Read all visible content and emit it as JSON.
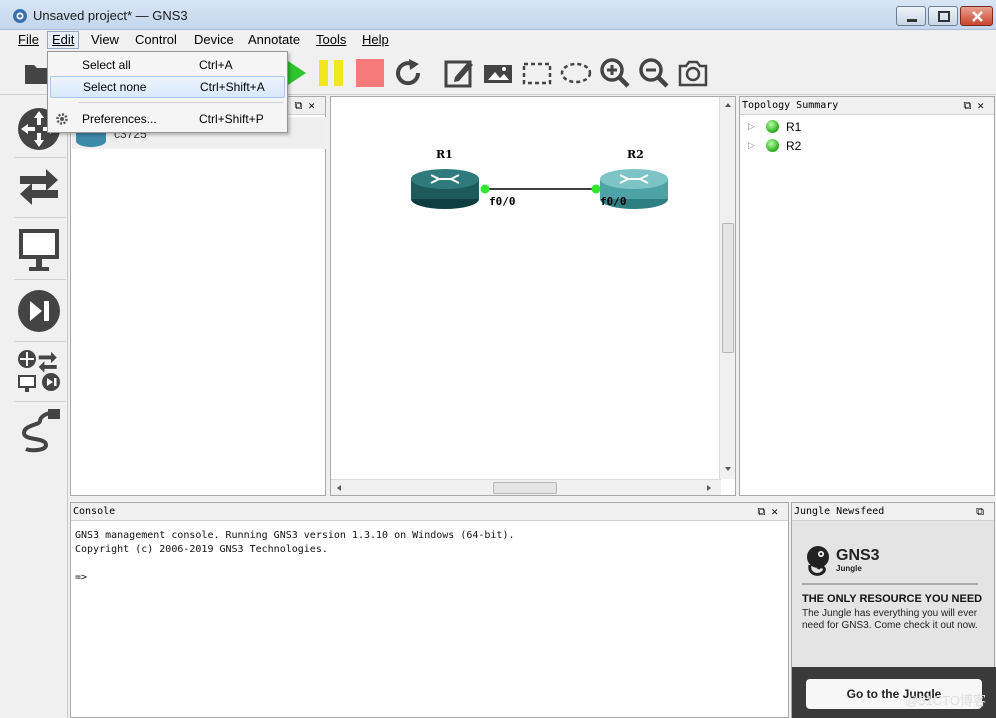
{
  "window": {
    "title": "Unsaved project* — GNS3"
  },
  "menubar": {
    "items": [
      "File",
      "Edit",
      "View",
      "Control",
      "Device",
      "Annotate",
      "Tools",
      "Help"
    ]
  },
  "edit_menu": {
    "items": [
      {
        "label": "Select all",
        "shortcut": "Ctrl+A"
      },
      {
        "label": "Select none",
        "shortcut": "Ctrl+Shift+A"
      },
      {
        "label": "Preferences...",
        "shortcut": "Ctrl+Shift+P"
      }
    ]
  },
  "devices_panel": {
    "items": [
      "c3725"
    ]
  },
  "canvas": {
    "nodes": [
      {
        "name": "R1"
      },
      {
        "name": "R2"
      }
    ],
    "links": [
      {
        "a_port": "f0/0",
        "b_port": "f0/0"
      }
    ]
  },
  "topology_summary": {
    "title": "Topology Summary",
    "items": [
      "R1",
      "R2"
    ],
    "status_color": "#30b020"
  },
  "console": {
    "title": "Console",
    "lines": [
      "GNS3 management console. Running GNS3 version 1.3.10 on Windows (64-bit).",
      "Copyright (c) 2006-2019 GNS3 Technologies.",
      "",
      "=>"
    ]
  },
  "jungle": {
    "title": "Jungle Newsfeed",
    "brand": "GNS3",
    "brand_sub": "Jungle",
    "headline": "THE ONLY RESOURCE YOU NEED",
    "body": "The Jungle has everything you will ever need for GNS3. Come check it out now.",
    "button": "Go to the Jungle"
  },
  "watermark": "@51CTO博客",
  "colors": {
    "router_dark": "#1d5a5c",
    "router_light": "#4ea3a6",
    "link_port": "#2ee82e",
    "stop_red": "#f77a7a",
    "pause_yellow": "#f4e61e",
    "play_green": "#2ec52e"
  }
}
